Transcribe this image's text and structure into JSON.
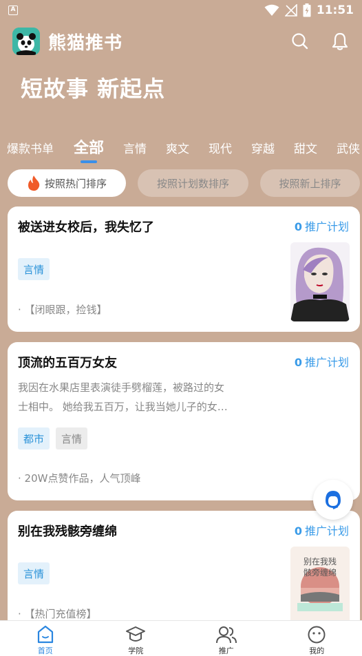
{
  "status_bar": {
    "time": "11:51",
    "left_icon": "A"
  },
  "header": {
    "app_name": "熊猫推书",
    "slogan": "短故事 新起点",
    "search_icon": "search-icon",
    "bell_icon": "bell-icon"
  },
  "category_tabs": [
    {
      "label": "爆款书单"
    },
    {
      "label": "全部"
    },
    {
      "label": "言情"
    },
    {
      "label": "爽文"
    },
    {
      "label": "现代"
    },
    {
      "label": "穿越"
    },
    {
      "label": "甜文"
    },
    {
      "label": "武侠"
    }
  ],
  "active_tab": "全部",
  "sort_options": [
    {
      "label": "按照热门排序"
    },
    {
      "label": "按照计划数排序"
    },
    {
      "label": "按照新上排序"
    }
  ],
  "books": [
    {
      "title": "被送进女校后，我失忆了",
      "plan_count": "0",
      "plan_label": "推广计划",
      "desc": "",
      "tags": [
        "言情"
      ],
      "feature": "· 【闭眼跟，捡钱】"
    },
    {
      "title": "顶流的五百万女友",
      "plan_count": "0",
      "plan_label": "推广计划",
      "desc_line1": "我因在水果店里表演徒手劈榴莲，被路过的女",
      "desc_line2": "士相中。 她给我五百万，让我当她儿子的女…",
      "tags": [
        "都市",
        "言情"
      ],
      "feature": "· 20W点赞作品，人气顶峰"
    },
    {
      "title": "别在我残骸旁缠绵",
      "plan_count": "0",
      "plan_label": "推广计划",
      "tags": [
        "言情"
      ],
      "feature": "· 【热门充值榜】",
      "cover_text_line1": "别在我残",
      "cover_text_line2": "骸旁缠绵"
    }
  ],
  "bottom_nav": [
    {
      "label": "首页",
      "icon": "home-icon"
    },
    {
      "label": "学院",
      "icon": "graduation-cap-icon"
    },
    {
      "label": "推广",
      "icon": "users-icon"
    },
    {
      "label": "我的",
      "icon": "profile-face-icon"
    }
  ],
  "colors": {
    "background": "#c9ab96",
    "accent": "#3a9be8",
    "tag_blue": "#2a92d8"
  }
}
